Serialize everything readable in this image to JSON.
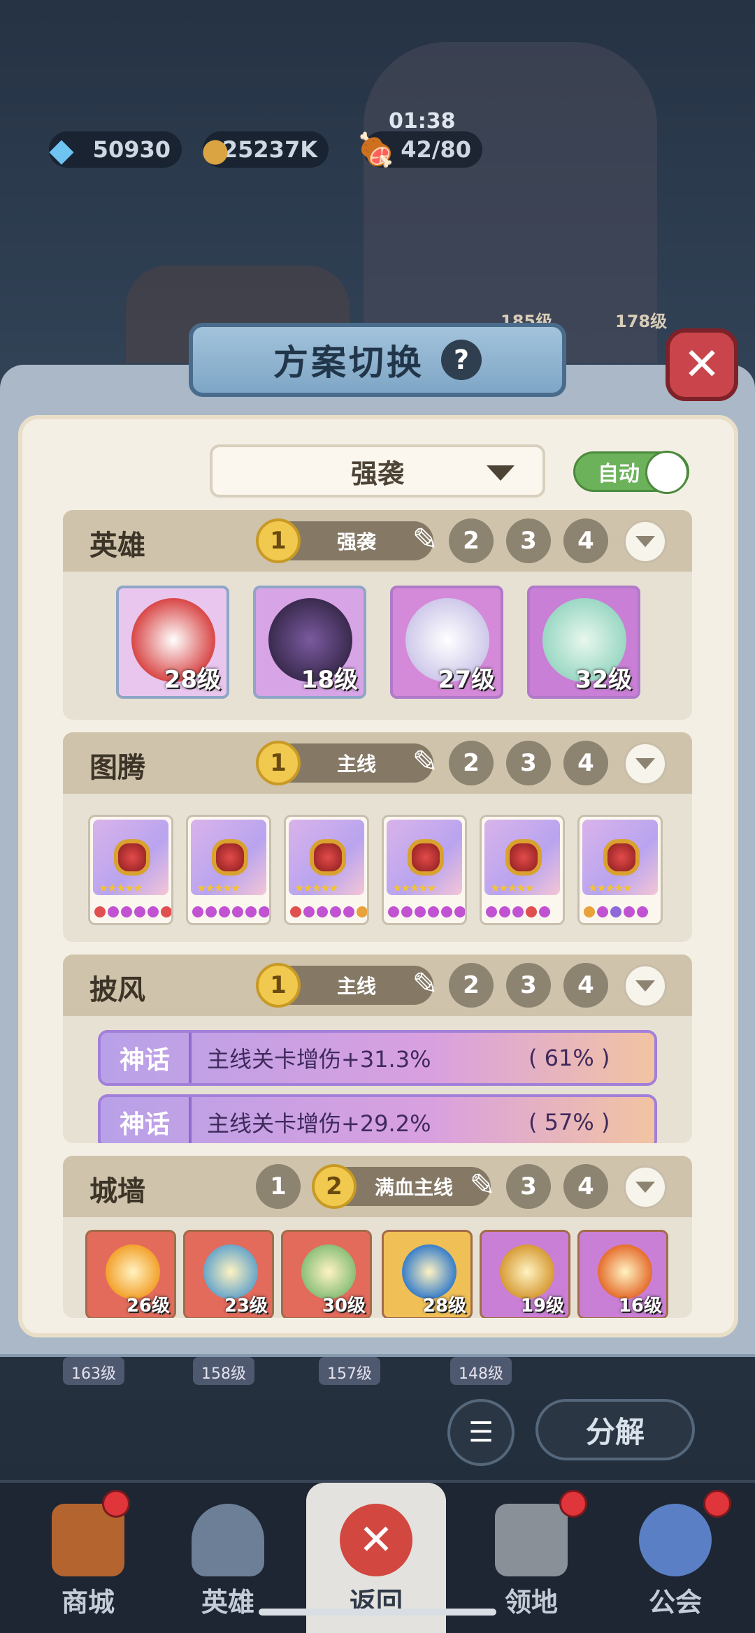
{
  "resources": {
    "diamonds": "50930",
    "gold": "25237K",
    "stamina_timer": "01:38",
    "stamina": "42/80"
  },
  "background_levels": [
    "185级",
    "178级"
  ],
  "modal": {
    "title": "方案切换",
    "help_symbol": "?",
    "close_symbol": "✕",
    "scheme_selected": "强袭",
    "auto_label": "自动",
    "auto_on": true
  },
  "sections": {
    "heroes": {
      "title": "英雄",
      "active_slot": "1",
      "active_name": "强袭",
      "other_slots": [
        "2",
        "3",
        "4"
      ],
      "cards": [
        {
          "level": "28级",
          "bg": "#e9c6ee",
          "art": "#d94848"
        },
        {
          "level": "18级",
          "bg": "#d7a4e6",
          "art": "#3b2b4f"
        },
        {
          "level": "27级",
          "bg": "#d48ad8",
          "art": "#cfc9ea"
        },
        {
          "level": "32级",
          "bg": "#c97fd6",
          "art": "#9bd8c4"
        }
      ]
    },
    "totems": {
      "title": "图腾",
      "active_slot": "1",
      "active_name": "主线",
      "other_slots": [
        "2",
        "3",
        "4"
      ],
      "cards": [
        {
          "dots": [
            "#e05050",
            "#c152d2",
            "#c152d2",
            "#c152d2",
            "#c152d2",
            "#e05050"
          ]
        },
        {
          "dots": [
            "#c152d2",
            "#c152d2",
            "#c152d2",
            "#c152d2",
            "#c152d2",
            "#c152d2"
          ]
        },
        {
          "dots": [
            "#e05050",
            "#c152d2",
            "#c152d2",
            "#c152d2",
            "#c152d2",
            "#e8a23a"
          ]
        },
        {
          "dots": [
            "#c152d2",
            "#c152d2",
            "#c152d2",
            "#c152d2",
            "#c152d2",
            "#c152d2"
          ]
        },
        {
          "dots": [
            "#c152d2",
            "#c152d2",
            "#c152d2",
            "#e05050",
            "#c152d2"
          ]
        },
        {
          "dots": [
            "#e8a23a",
            "#c152d2",
            "#8d6ad8",
            "#c152d2",
            "#c152d2"
          ]
        }
      ],
      "stars": "★★★★★"
    },
    "capes": {
      "title": "披风",
      "active_slot": "1",
      "active_name": "主线",
      "other_slots": [
        "2",
        "3",
        "4"
      ],
      "rows": [
        {
          "rarity": "神话",
          "effect": "主线关卡增伤+31.3%",
          "percent": "( 61% )"
        },
        {
          "rarity": "神话",
          "effect": "主线关卡增伤+29.2%",
          "percent": "( 57% )"
        }
      ]
    },
    "walls": {
      "title": "城墙",
      "slot_before": "1",
      "active_slot": "2",
      "active_name": "满血主线",
      "other_slots": [
        "3",
        "4"
      ],
      "cards": [
        {
          "level": "26级",
          "bg": "#e26b5c",
          "art": "#f3a22e"
        },
        {
          "level": "23级",
          "bg": "#e26b5c",
          "art": "#6aa7c9"
        },
        {
          "level": "30级",
          "bg": "#e26b5c",
          "art": "#8cc07a"
        },
        {
          "level": "28级",
          "bg": "#f0c056",
          "art": "#3a7fc9"
        },
        {
          "level": "19级",
          "bg": "#c97fd6",
          "art": "#d79c37"
        },
        {
          "level": "16级",
          "bg": "#c97fd6",
          "art": "#e56e2e"
        }
      ]
    }
  },
  "under_modal_levels": [
    "163级",
    "158级",
    "157级",
    "148级"
  ],
  "decompose_label": "分解",
  "bottom_nav": [
    {
      "label": "商城",
      "icon": "shop-icon",
      "badge": true
    },
    {
      "label": "英雄",
      "icon": "helmet-icon",
      "badge": false
    },
    {
      "label": "返回",
      "icon": "close-icon",
      "badge": false,
      "active": true
    },
    {
      "label": "领地",
      "icon": "castle-icon",
      "badge": true
    },
    {
      "label": "公会",
      "icon": "planet-icon",
      "badge": true
    }
  ]
}
